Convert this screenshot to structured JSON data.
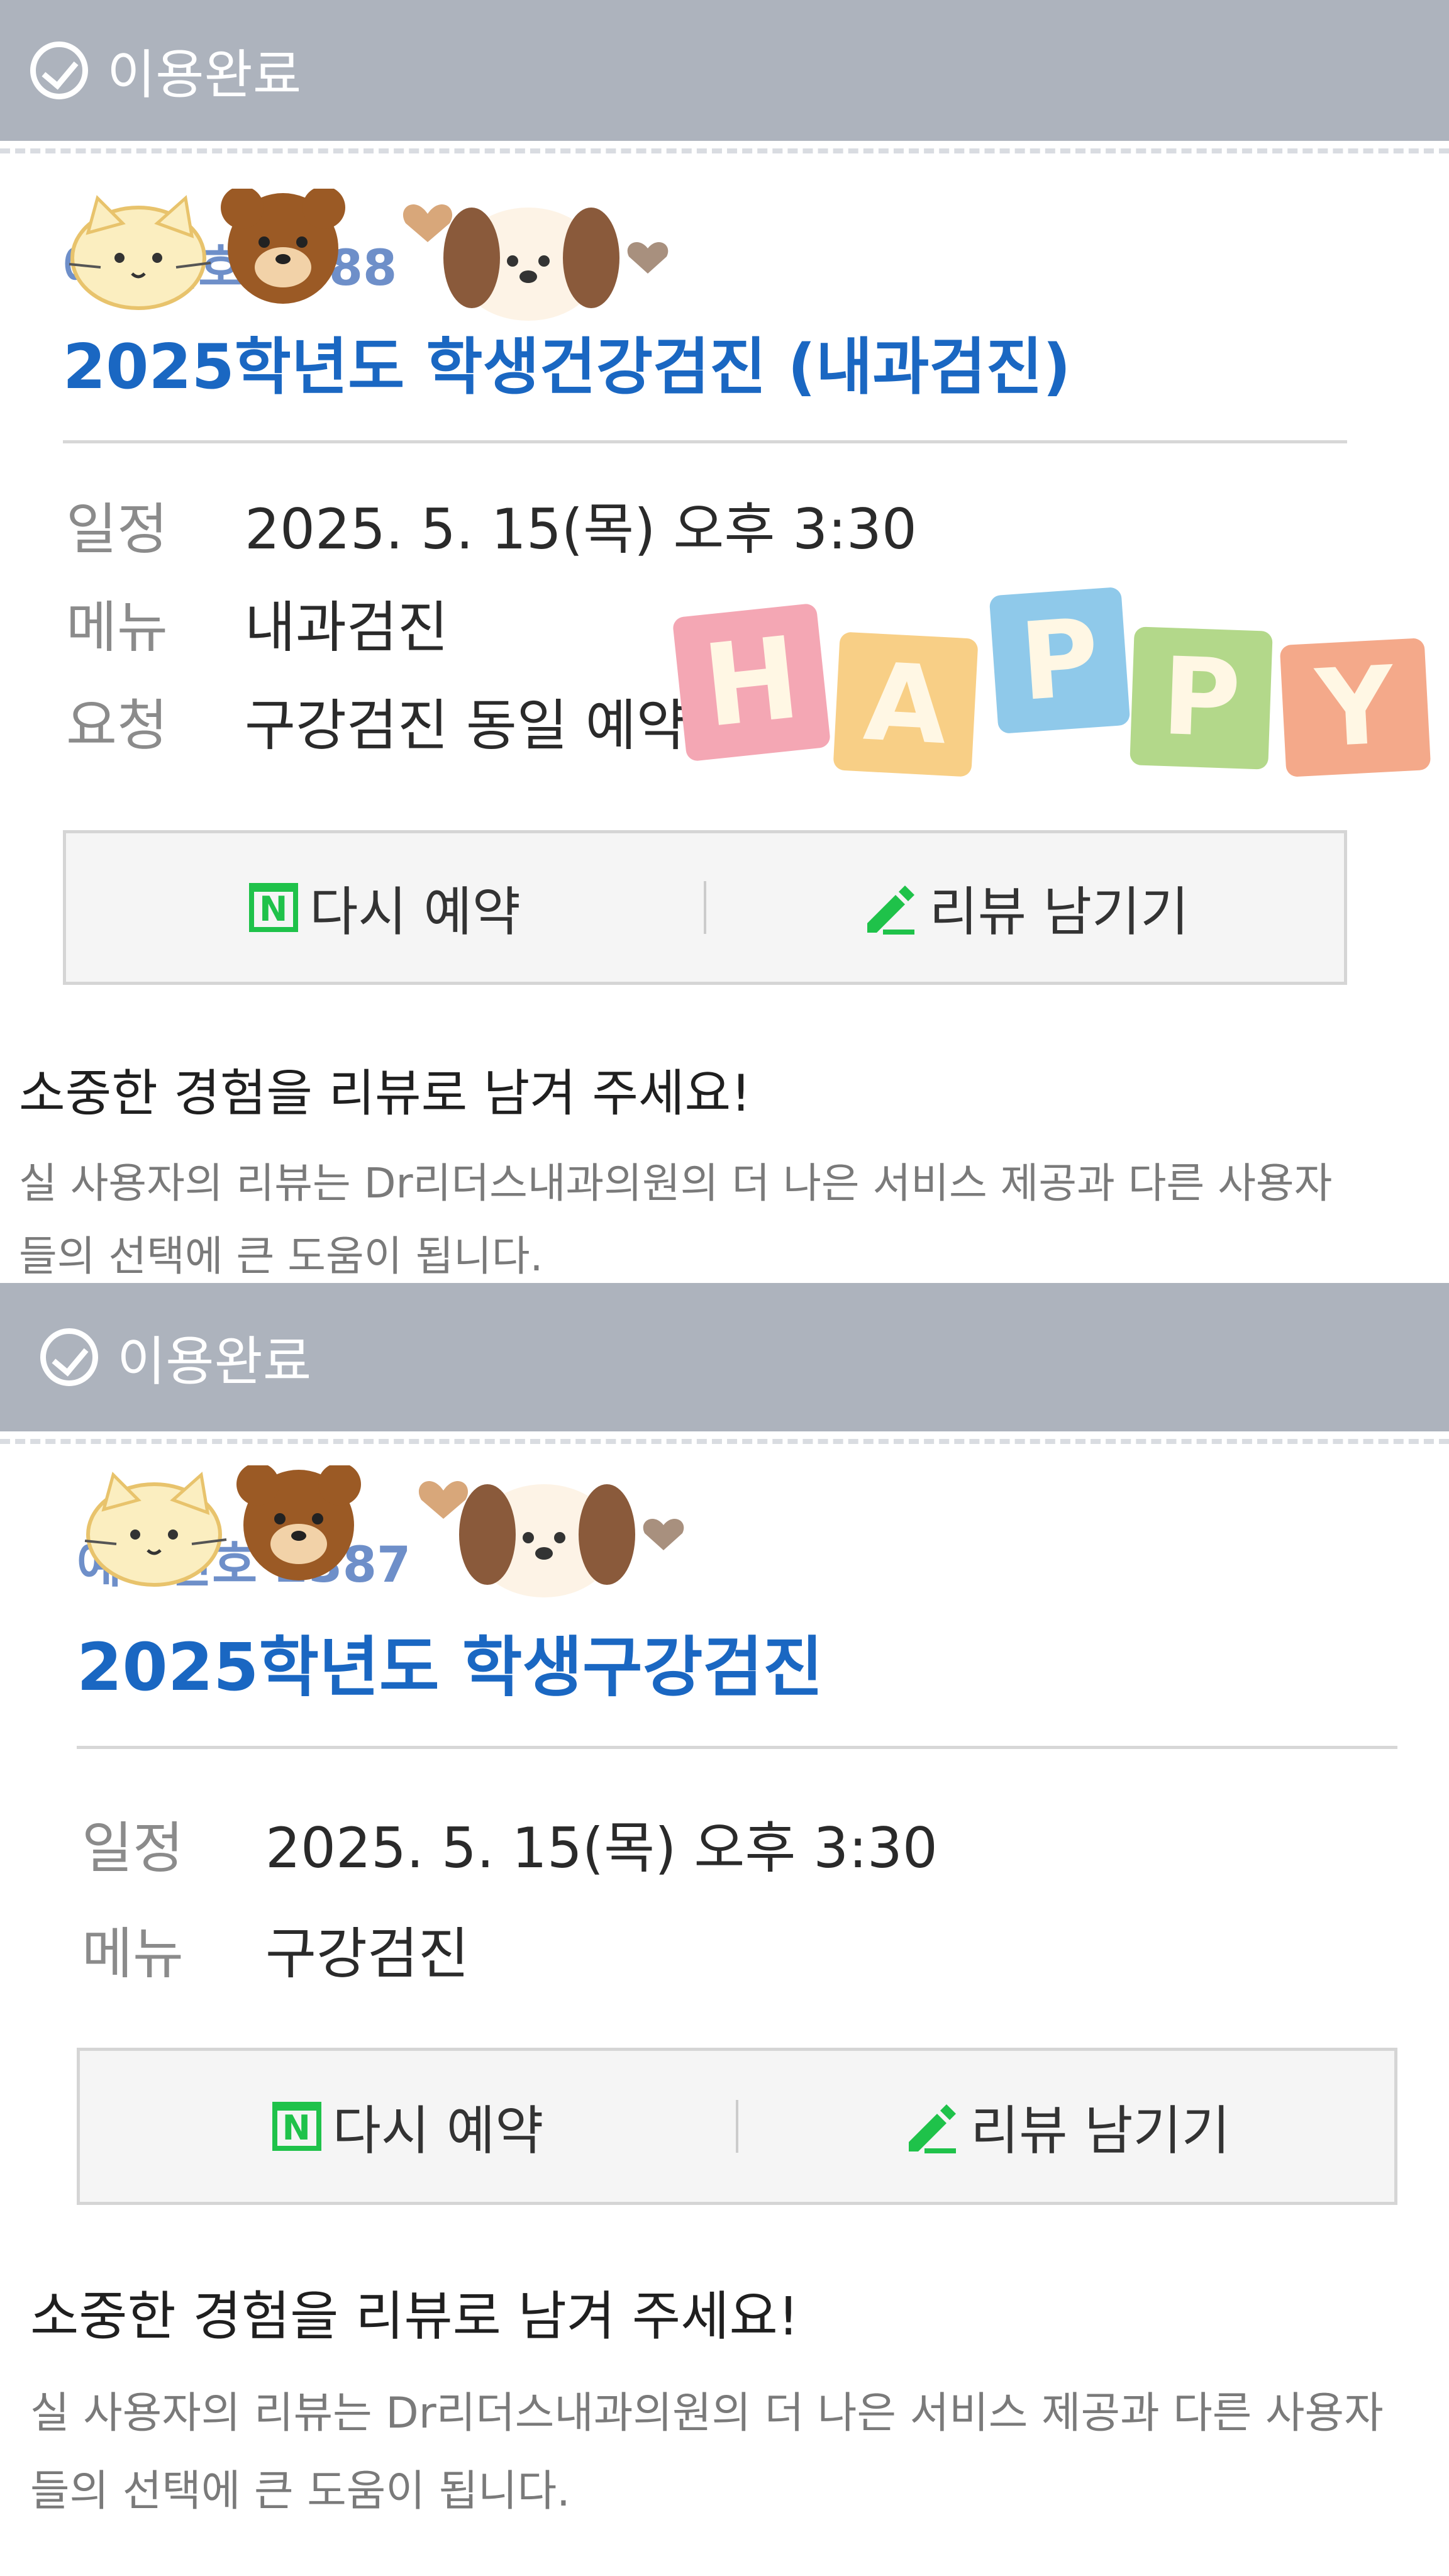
{
  "reservations": [
    {
      "status": "이용완료",
      "booking_no": "예약번호 2388",
      "title": "2025학년도 학생건강검진 (내과검진)",
      "rows": [
        {
          "label": "일정",
          "value": "2025. 5. 15(목) 오후 3:30"
        },
        {
          "label": "메뉴",
          "value": "내과검진"
        },
        {
          "label": "요청",
          "value": "구강검진 동일 예약 /"
        }
      ],
      "rebook_label": "다시 예약",
      "review_label": "리뷰 남기기",
      "promo_title": "소중한 경험을 리뷰로 남겨 주세요!",
      "promo_desc_line1": "실 사용자의 리뷰는 Dr리더스내과의원의 더 나은 서비스 제공과 다른 사용자",
      "promo_desc_line2": "들의 선택에 큰 도움이 됩니다."
    },
    {
      "status": "이용완료",
      "booking_no": "예약번호 2387",
      "title": "2025학년도 학생구강검진",
      "rows": [
        {
          "label": "일정",
          "value": "2025. 5. 15(목) 오후 3:30"
        },
        {
          "label": "메뉴",
          "value": "구강검진"
        }
      ],
      "rebook_label": "다시 예약",
      "review_label": "리뷰 남기기",
      "promo_title": "소중한 경험을 리뷰로 남겨 주세요!",
      "promo_desc_line1": "실 사용자의 리뷰는 Dr리더스내과의원의 더 나은 서비스 제공과 다른 사용자",
      "promo_desc_line2": "들의 선택에 큰 도움이 됩니다."
    }
  ],
  "stickers": {
    "happy_letters": [
      "H",
      "A",
      "P",
      "P",
      "Y"
    ],
    "happy_colors": [
      "#f4a7b4",
      "#f8cf86",
      "#8fc9ea",
      "#b3d88a",
      "#f4a98a"
    ],
    "animal_icons": [
      "cat-icon",
      "bear-icon",
      "heart-icon",
      "dog-icon"
    ]
  },
  "colors": {
    "status_bar": "#adb3bd",
    "title_blue": "#1a67c2",
    "naver_green": "#1fc24a"
  }
}
